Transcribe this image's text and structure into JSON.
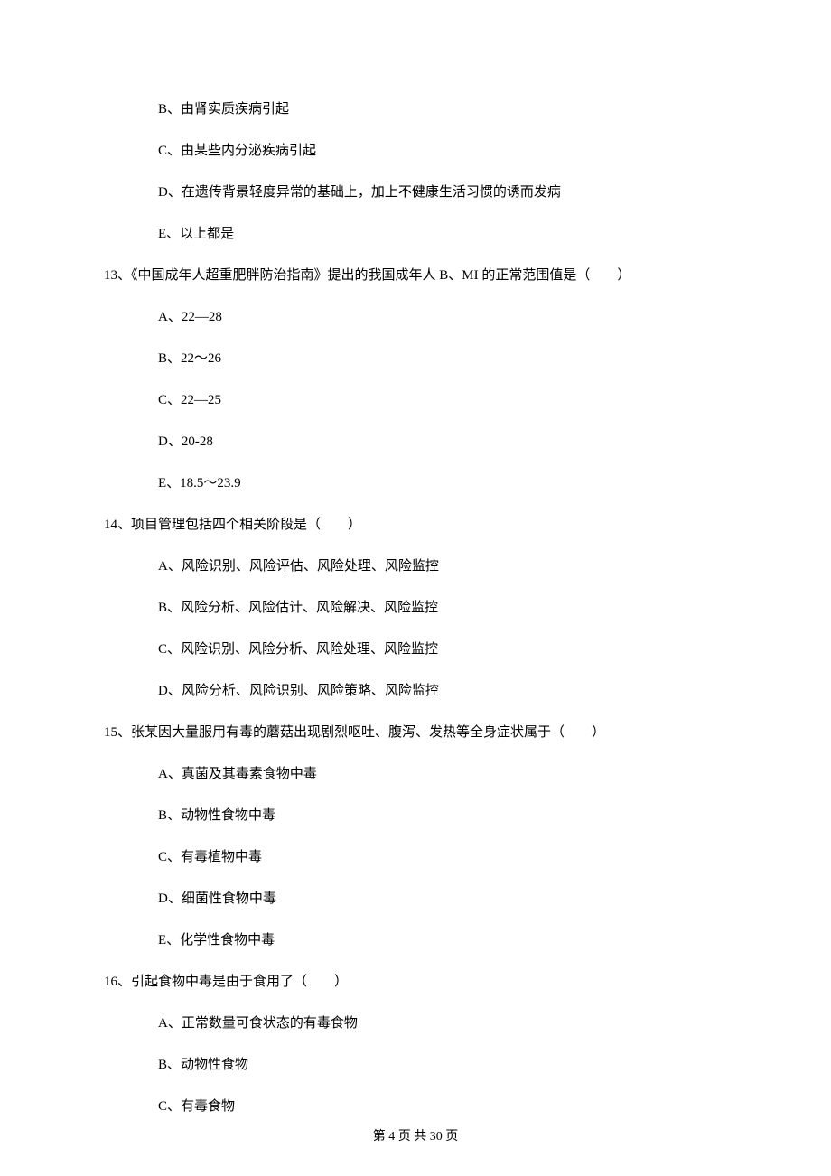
{
  "prev_options": {
    "b": "B、由肾实质疾病引起",
    "c": "C、由某些内分泌疾病引起",
    "d": "D、在遗传背景轻度异常的基础上，加上不健康生活习惯的诱而发病",
    "e": "E、以上都是"
  },
  "questions": [
    {
      "stem": "13、《中国成年人超重肥胖防治指南》提出的我国成年人 B、MI 的正常范围值是（　　）",
      "options": [
        "A、22—28",
        "B、22～26",
        "C、22—25",
        "D、20-28",
        "E、18.5～23.9"
      ]
    },
    {
      "stem": "14、项目管理包括四个相关阶段是（　　）",
      "options": [
        "A、风险识别、风险评估、风险处理、风险监控",
        "B、风险分析、风险估计、风险解决、风险监控",
        "C、风险识别、风险分析、风险处理、风险监控",
        "D、风险分析、风险识别、风险策略、风险监控"
      ]
    },
    {
      "stem": "15、张某因大量服用有毒的蘑菇出现剧烈呕吐、腹泻、发热等全身症状属于（　　）",
      "options": [
        "A、真菌及其毒素食物中毒",
        "B、动物性食物中毒",
        "C、有毒植物中毒",
        "D、细菌性食物中毒",
        "E、化学性食物中毒"
      ]
    },
    {
      "stem": "16、引起食物中毒是由于食用了（　　）",
      "options": [
        "A、正常数量可食状态的有毒食物",
        "B、动物性食物",
        "C、有毒食物"
      ]
    }
  ],
  "footer": "第 4 页 共 30 页"
}
